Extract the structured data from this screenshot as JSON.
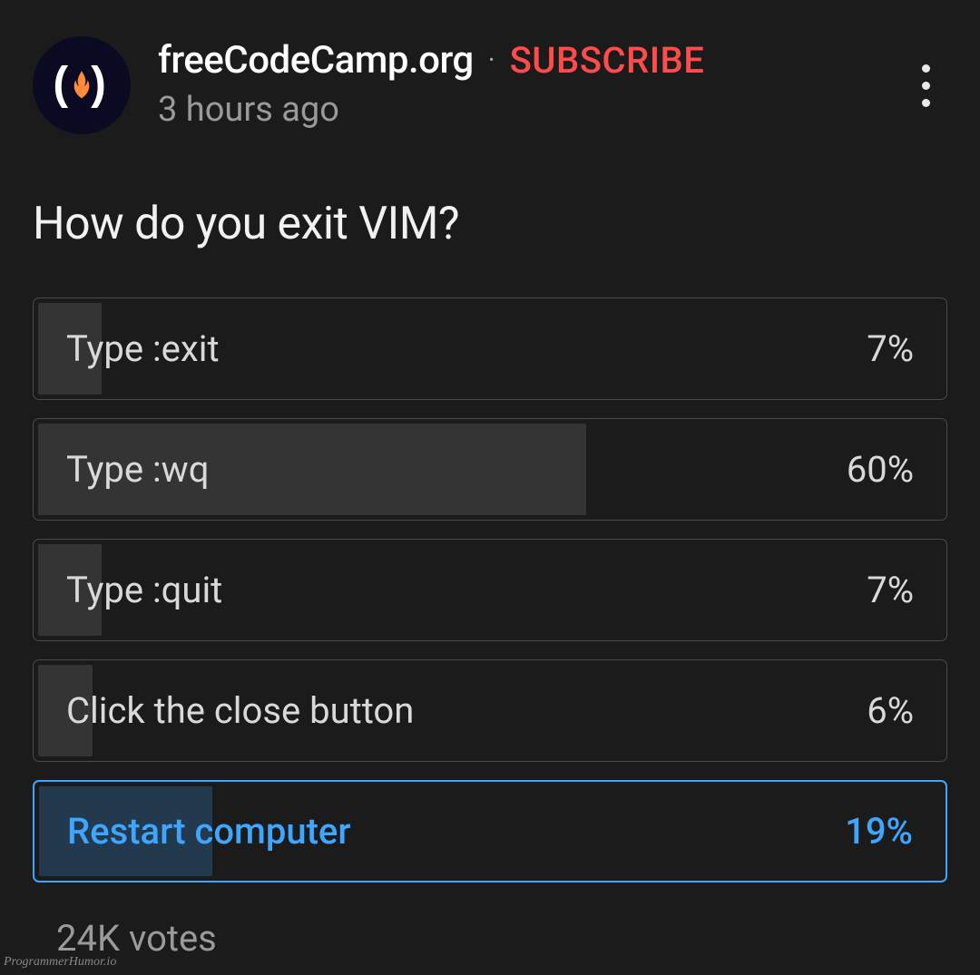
{
  "channel": {
    "name": "freeCodeCamp.org",
    "subscribe_label": "SUBSCRIBE",
    "timestamp": "3 hours ago"
  },
  "poll": {
    "question": "How do you exit VIM?",
    "options": [
      {
        "label": "Type :exit",
        "pct": "7%",
        "fill": 7,
        "selected": false
      },
      {
        "label": "Type :wq",
        "pct": "60%",
        "fill": 60,
        "selected": false
      },
      {
        "label": "Type :quit",
        "pct": "7%",
        "fill": 7,
        "selected": false
      },
      {
        "label": "Click the close button",
        "pct": "6%",
        "fill": 6,
        "selected": false
      },
      {
        "label": "Restart computer",
        "pct": "19%",
        "fill": 19,
        "selected": true
      }
    ],
    "votes": "24K votes"
  },
  "watermark": "ProgrammerHumor.io"
}
